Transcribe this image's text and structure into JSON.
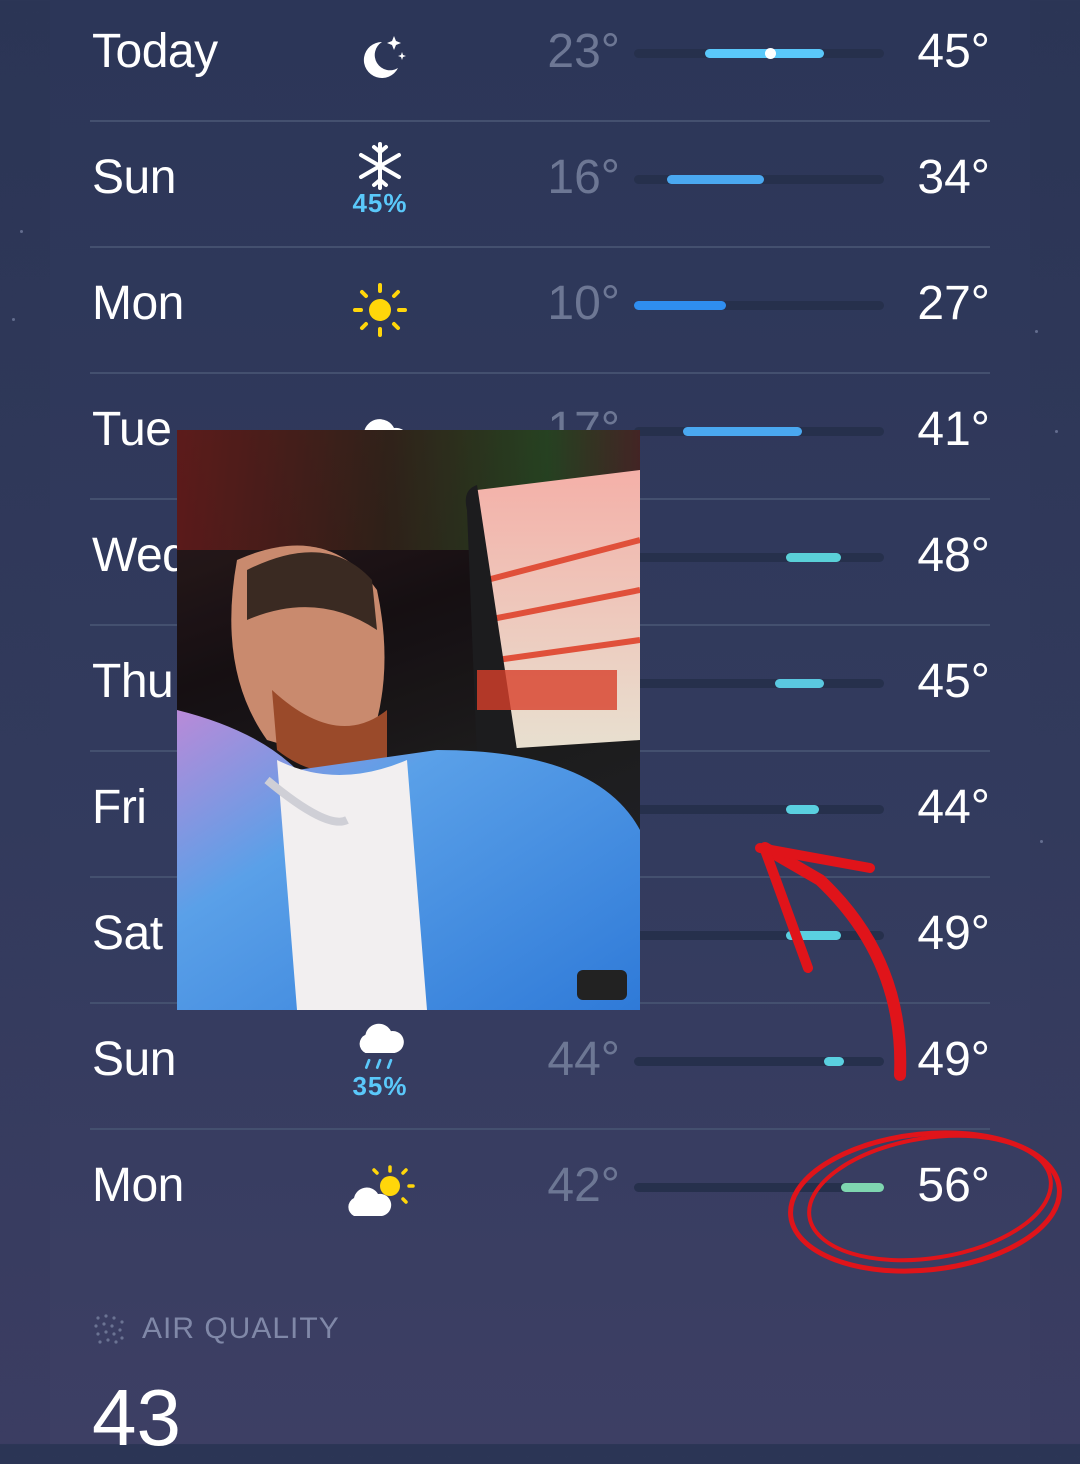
{
  "forecast": [
    {
      "day": "Today",
      "icon": "moon-stars-icon",
      "precip": "",
      "low": "23°",
      "high": "45°",
      "low_value": 23,
      "high_value": 45,
      "current_value": 35,
      "bar_color": "#5ac8fa"
    },
    {
      "day": "Sun",
      "icon": "snowflake-icon",
      "precip": "45%",
      "low": "16°",
      "high": "34°",
      "low_value": 16,
      "high_value": 34,
      "bar_color": "#4aa8f0"
    },
    {
      "day": "Mon",
      "icon": "sun-icon",
      "precip": "",
      "low": "10°",
      "high": "27°",
      "low_value": 10,
      "high_value": 27,
      "bar_color": "#2f8ef0"
    },
    {
      "day": "Tue",
      "icon": "cloud-icon",
      "precip": "",
      "low": "17°",
      "high": "41°",
      "low_value": 19,
      "high_value": 41,
      "bar_color": "#4aa8f0"
    },
    {
      "day": "Wed",
      "icon": "",
      "precip": "",
      "low": "",
      "high": "48°",
      "low_value": 38,
      "high_value": 48,
      "bar_color": "#5ad0d8"
    },
    {
      "day": "Thu",
      "icon": "",
      "precip": "",
      "low": "",
      "high": "45°",
      "low_value": 36,
      "high_value": 45,
      "bar_color": "#5ac8e0"
    },
    {
      "day": "Fri",
      "icon": "",
      "precip": "",
      "low": "",
      "high": "44°",
      "low_value": 38,
      "high_value": 44,
      "bar_color": "#5ad0e0"
    },
    {
      "day": "Sat",
      "icon": "",
      "precip": "",
      "low": "",
      "high": "49°",
      "low_value": 38,
      "high_value": 48,
      "bar_color": "#5ad0e0"
    },
    {
      "day": "Sun",
      "icon": "cloud-rain-icon",
      "precip": "35%",
      "low": "44°",
      "high": "49°",
      "low_value": 45,
      "high_value": 48,
      "bar_color": "#5ad0e0"
    },
    {
      "day": "Mon",
      "icon": "sun-cloud-icon",
      "precip": "",
      "low": "42°",
      "high": "56°",
      "low_value": 48,
      "high_value": 56,
      "bar_color": "#7fd6b0"
    }
  ],
  "scale": {
    "min": 10,
    "max": 56
  },
  "air_quality": {
    "label": "AIR QUALITY",
    "value": "43"
  },
  "overlay": {
    "annotation_color": "#e0141a"
  }
}
